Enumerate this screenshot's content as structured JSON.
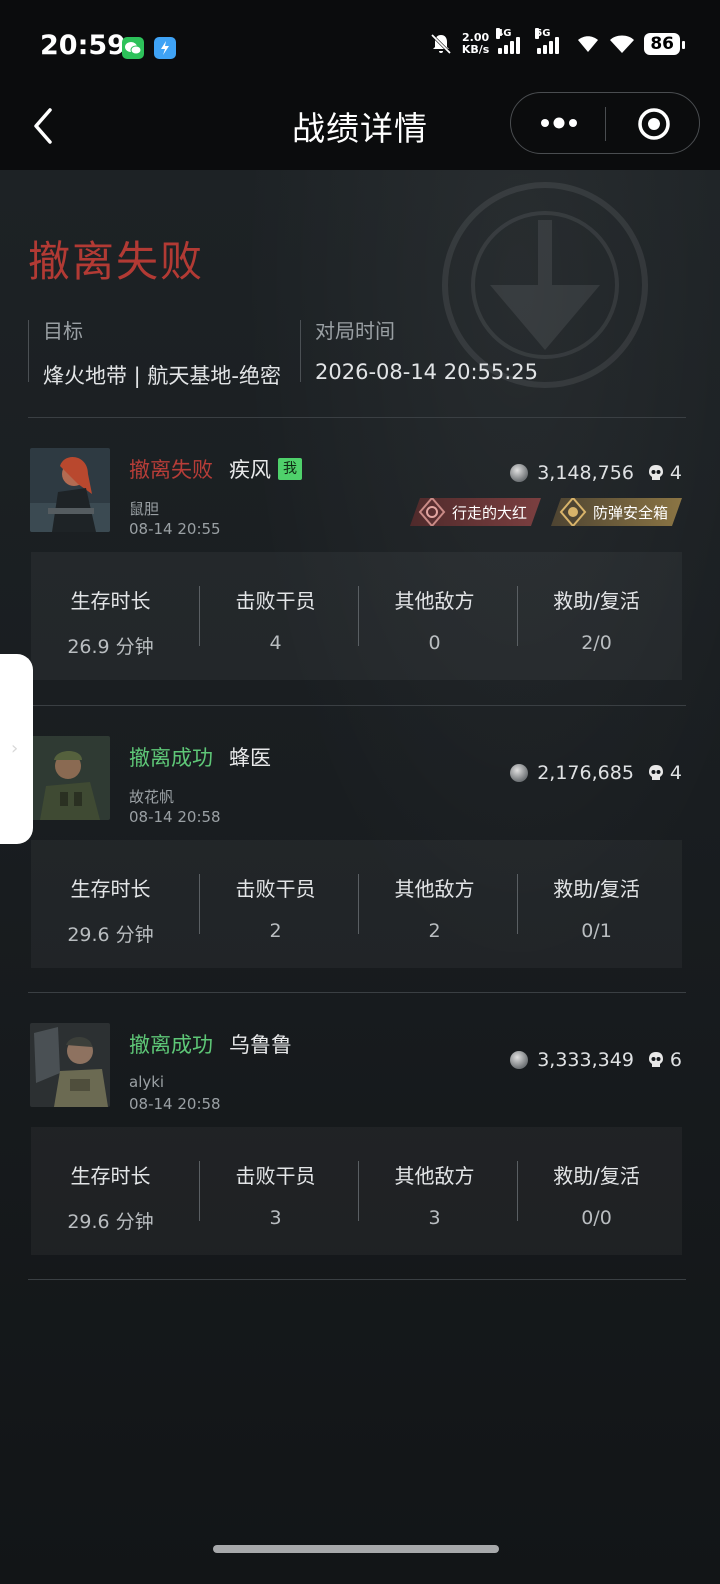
{
  "status_bar": {
    "time": "20:59",
    "net_speed_value": "2.00",
    "net_speed_unit": "KB/s",
    "signal_1": "4G",
    "signal_2": "5G",
    "battery": "86",
    "icons": [
      "wechat-icon",
      "app-icon",
      "mute-icon",
      "wifi-icon",
      "battery-icon"
    ]
  },
  "nav": {
    "title": "战绩详情",
    "icons": [
      "back-chevron-icon",
      "more-dots-icon",
      "close-target-icon"
    ]
  },
  "match": {
    "result": "撤离失败",
    "target_label": "目标",
    "target_value": "烽火地带 | 航天基地-绝密",
    "time_label": "对局时间",
    "time_value": "2026-08-14 20:55:25"
  },
  "stat_labels": [
    "生存时长",
    "击败干员",
    "其他敌方",
    "救助/复活"
  ],
  "players": [
    {
      "status": "撤离失败",
      "status_type": "fail",
      "name": "疾风",
      "me_badge": "我",
      "tag": "鼠胆",
      "time": "08-14 20:55",
      "value": "3,148,756",
      "kills": "4",
      "badges": [
        {
          "label": "行走的大红",
          "style": "red"
        },
        {
          "label": "防弹安全箱",
          "style": "gold"
        }
      ],
      "stats": [
        "26.9 分钟",
        "4",
        "0",
        "2/0"
      ]
    },
    {
      "status": "撤离成功",
      "status_type": "ok",
      "name": "蜂医",
      "tag": "故花帆",
      "time": "08-14 20:58",
      "value": "2,176,685",
      "kills": "4",
      "stats": [
        "29.6 分钟",
        "2",
        "2",
        "0/1"
      ]
    },
    {
      "status": "撤离成功",
      "status_type": "ok",
      "name": "乌鲁鲁",
      "tag": "alyki",
      "time": "08-14 20:58",
      "value": "3,333,349",
      "kills": "6",
      "stats": [
        "29.6 分钟",
        "3",
        "3",
        "0/0"
      ]
    }
  ],
  "colors": {
    "fail": "#b63d38",
    "success": "#5ec777",
    "background": "#14181b"
  }
}
